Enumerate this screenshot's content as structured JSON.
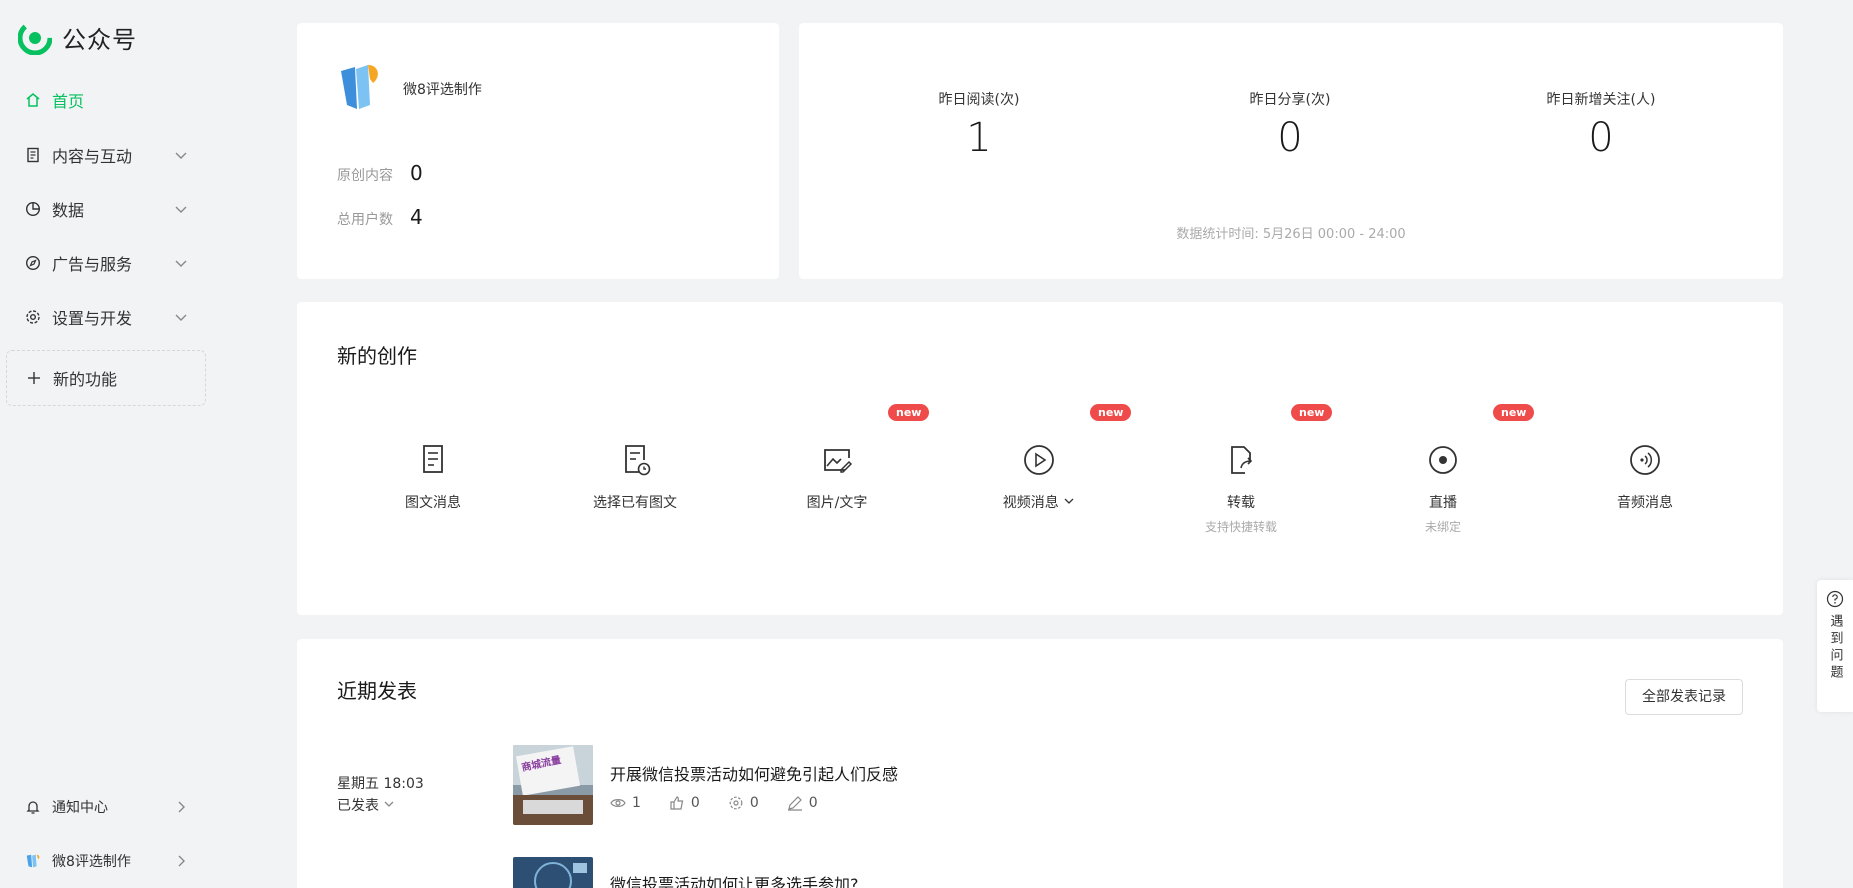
{
  "brand": {
    "title": "公众号",
    "logo_icon": "wechat-mp-logo",
    "accent": "#07c160"
  },
  "sidebar": {
    "items": [
      {
        "label": "首页",
        "icon": "home-icon",
        "active": true
      },
      {
        "label": "内容与互动",
        "icon": "document-icon"
      },
      {
        "label": "数据",
        "icon": "pie-chart-icon"
      },
      {
        "label": "广告与服务",
        "icon": "compass-icon"
      },
      {
        "label": "设置与开发",
        "icon": "gear-icon"
      }
    ],
    "new_feature": "新的功能",
    "notice": "通知中心",
    "account": "微8评选制作"
  },
  "account_card": {
    "name": "微8评选制作",
    "original_label": "原创内容",
    "original_value": "0",
    "users_label": "总用户数",
    "users_value": "4"
  },
  "stats_card": {
    "metrics": [
      {
        "label": "昨日阅读(次)",
        "value": "1"
      },
      {
        "label": "昨日分享(次)",
        "value": "0"
      },
      {
        "label": "昨日新增关注(人)",
        "value": "0"
      }
    ],
    "time_note": "数据统计时间: 5月26日 00:00 - 24:00"
  },
  "create": {
    "title": "新的创作",
    "badge_text": "new",
    "items": [
      {
        "label": "图文消息",
        "sub": ""
      },
      {
        "label": "选择已有图文",
        "sub": ""
      },
      {
        "label": "图片/文字",
        "sub": ""
      },
      {
        "label": "视频消息",
        "sub": ""
      },
      {
        "label": "转载",
        "sub": "支持快捷转载"
      },
      {
        "label": "直播",
        "sub": "未绑定"
      },
      {
        "label": "音频消息",
        "sub": ""
      }
    ]
  },
  "recent": {
    "title": "近期发表",
    "all_button": "全部发表记录",
    "posts": [
      {
        "date": "星期五 18:03",
        "status": "已发表",
        "title": "开展微信投票活动如何避免引起人们反感",
        "views": "1",
        "likes": "0",
        "shares": "0",
        "comments": "0",
        "thumb_text": "商城流量"
      },
      {
        "title": "微信投票活动如何让更多选手参加?"
      }
    ]
  },
  "help": {
    "text": "遇到问题"
  }
}
